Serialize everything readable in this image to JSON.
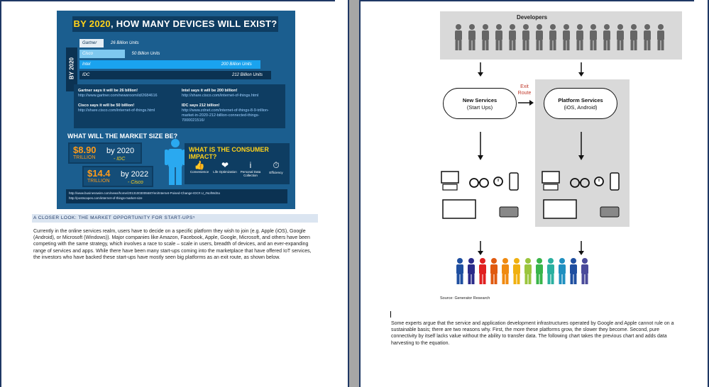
{
  "infographic": {
    "title_prefix": "BY 2020",
    "title_rest": ", HOW MANY DEVICES WILL EXIST?",
    "year_label": "BY 2020",
    "bars": [
      {
        "name": "Gartner",
        "value_label": "26 Billion Units",
        "value": 26,
        "color": "#e6eef5"
      },
      {
        "name": "Cisco",
        "value_label": "50 Billion Units",
        "value": 50,
        "color": "#7ec8f0"
      },
      {
        "name": "Intel",
        "value_label": "200 Billion Units",
        "value": 200,
        "color": "#1aa3ef"
      },
      {
        "name": "IDC",
        "value_label": "212 Billion Units",
        "value": 212,
        "color": "#0b3252"
      }
    ],
    "sources": [
      {
        "text": "Gartner says it will be 26 billion!",
        "url": "http://www.gartner.com/newsroom/id/2684616"
      },
      {
        "text": "Intel says it will be 200 billion!",
        "url": "http://share.cisco.com/internet-of-things.html"
      },
      {
        "text": "Cisco says it will be 50 billion!",
        "url": "http://share.cisco.com/internet-of-things.html"
      },
      {
        "text": "IDC says 212 billion!",
        "url": "http://www.zdnet.com/internet-of-things-8-9-trillion-market-in-2020-212-billion-connected-things-7000021516/"
      }
    ],
    "market_heading": "WHAT WILL THE MARKET SIZE BE?",
    "market": [
      {
        "amount": "$8.90",
        "unit": "TRILLION",
        "year": "by 2020",
        "source": "- IDC"
      },
      {
        "amount": "$14.4",
        "unit": "TRILLION",
        "year": "by 2022",
        "source": "- Cisco"
      }
    ],
    "consumer_heading": "WHAT IS THE CONSUMER IMPACT?",
    "impacts": [
      {
        "label": "Convenience",
        "icon": "thumbs-up-icon",
        "glyph": "👍"
      },
      {
        "label": "Life Optimization",
        "icon": "heart-icon",
        "glyph": "❤"
      },
      {
        "label": "Personal Data Collection",
        "icon": "info-icon",
        "glyph": "i"
      },
      {
        "label": "Efficiency",
        "icon": "stopwatch-icon",
        "glyph": "⏱"
      }
    ],
    "footer_urls": [
      "http://www.businesswire.com/news/home/20131003005687/en/Internet-Poised-Change-IDC#.U_rNofWdSo",
      "http://postscapes.com/internet-of-things-market-size"
    ]
  },
  "left_text": {
    "heading": "A CLOSER LOOK: THE MARKET OPPORTUNITY FOR START-UPS⁵",
    "paragraph": "Currently in the online services realm, users have to decide on a specific platform they wish to join (e.g. Apple (iOS), Google (Android), or Microsoft (Windows)). Major companies like Amazon, Facebook, Apple, Google, Microsoft, and others have been competing with the same strategy, which involves a race to scale – scale in users, breadth of devices, and an ever-expanding range of services and apps. While there have been many start-ups coming into the marketplace that have offered IoT services, the investors who have backed these start-ups have mostly seen big platforms as an exit route, as shown below."
  },
  "diagram": {
    "developers_label": "Developers",
    "new_services": "New Services",
    "new_services_sub": "(Start Ups)",
    "platform_services": "Platform Services",
    "platform_services_sub": "(iOS, Android)",
    "exit_route": "Exit Route",
    "people_colors": [
      "#1f4fa0",
      "#2b2b8a",
      "#e02020",
      "#e05a10",
      "#f08a10",
      "#f0b010",
      "#9bc53d",
      "#39b54a",
      "#2bb0a0",
      "#2090c0",
      "#1f4fa0",
      "#4a4a9a"
    ],
    "source_note": "Source: Generator Research"
  },
  "right_text": {
    "paragraph": "Some experts argue that the service and application development infrastructures operated by Google and Apple cannot rule on a sustainable basis; there are two reasons why. First, the more these platforms grow, the slower they become. Second, pure connectivity by itself lacks value without the ability to transfer data. The following chart takes the previous chart and adds data harvesting to the equation."
  }
}
